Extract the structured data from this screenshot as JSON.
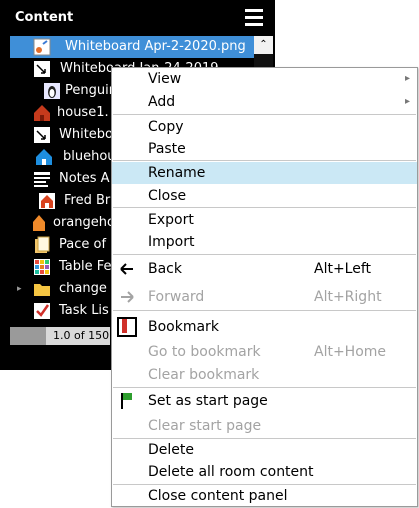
{
  "panel": {
    "title": "Content",
    "tree": [
      {
        "label": "Whiteboard Apr-2-2020.png",
        "icon": "whiteboard-image-icon",
        "selected": true
      },
      {
        "label": "Whiteboard Jan-24-2019",
        "icon": "whiteboard-icon"
      },
      {
        "label": "Penguin",
        "icon": "penguin-image-icon"
      },
      {
        "label": "house1.",
        "icon": "red-house-icon"
      },
      {
        "label": "Whiteboard",
        "icon": "whiteboard-icon"
      },
      {
        "label": "bluehouse",
        "icon": "blue-house-icon"
      },
      {
        "label": "Notes A",
        "icon": "notes-icon"
      },
      {
        "label": "Fred Br",
        "icon": "house-image-icon"
      },
      {
        "label": "orangeho",
        "icon": "orange-house-icon"
      },
      {
        "label": "Pace of",
        "icon": "document-icon"
      },
      {
        "label": "Table Fe",
        "icon": "table-icon"
      },
      {
        "label": "change",
        "icon": "folder-icon"
      },
      {
        "label": "Task Lis",
        "icon": "checklist-icon"
      }
    ],
    "pager_text": "1.0 of 150"
  },
  "context_menu": {
    "items": [
      {
        "label": "View",
        "shortcut": "",
        "submenu": true,
        "disabled": false
      },
      {
        "label": "Add",
        "shortcut": "",
        "submenu": true,
        "disabled": false
      },
      {
        "label": "Copy",
        "shortcut": "",
        "disabled": false
      },
      {
        "label": "Paste",
        "shortcut": "",
        "disabled": false
      },
      {
        "label": "Rename",
        "shortcut": "",
        "disabled": false,
        "highlighted": true
      },
      {
        "label": "Close",
        "shortcut": "",
        "disabled": false
      },
      {
        "label": "Export",
        "shortcut": "",
        "disabled": false
      },
      {
        "label": "Import",
        "shortcut": "",
        "disabled": false
      },
      {
        "label": "Back",
        "shortcut": "Alt+Left",
        "icon": "back-arrow-icon",
        "disabled": false
      },
      {
        "label": "Forward",
        "shortcut": "Alt+Right",
        "icon": "forward-arrow-icon",
        "disabled": true
      },
      {
        "label": "Bookmark",
        "shortcut": "",
        "icon": "bookmark-icon",
        "disabled": false
      },
      {
        "label": "Go to bookmark",
        "shortcut": "Alt+Home",
        "disabled": true
      },
      {
        "label": "Clear bookmark",
        "shortcut": "",
        "disabled": true
      },
      {
        "label": "Set as start page",
        "shortcut": "",
        "icon": "start-flag-icon",
        "disabled": false
      },
      {
        "label": "Clear start page",
        "shortcut": "",
        "disabled": true
      },
      {
        "label": "Delete",
        "shortcut": "",
        "disabled": false
      },
      {
        "label": "Delete all room content",
        "shortcut": "",
        "disabled": false
      },
      {
        "label": "Close content panel",
        "shortcut": "",
        "disabled": false
      }
    ]
  },
  "colors": {
    "selection": "#3f8fd8",
    "menu_highlight": "#cbe8f5",
    "disabled_text": "#a3a3a3"
  }
}
